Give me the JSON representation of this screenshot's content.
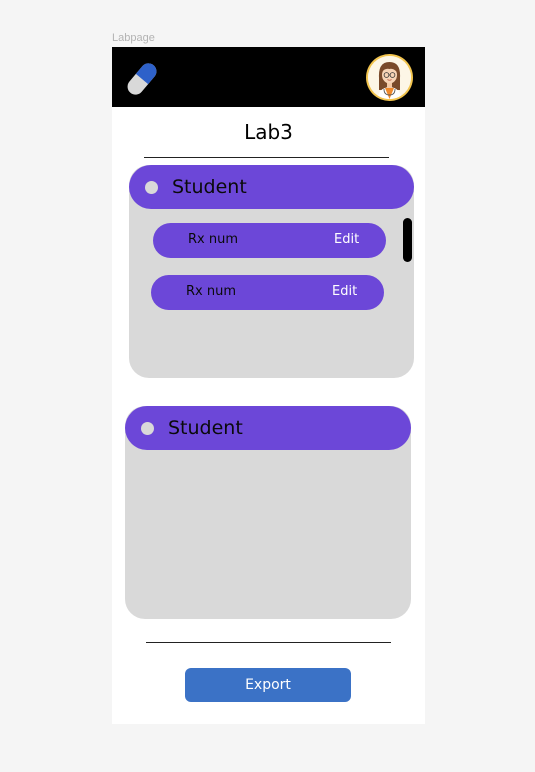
{
  "frame": {
    "label": "Labpage"
  },
  "header": {
    "logo_icon": "pill-icon",
    "avatar_icon": "doctor-avatar-icon"
  },
  "page": {
    "title": "Lab3"
  },
  "cards": [
    {
      "label": "Student",
      "items": [
        {
          "label": "Rx num",
          "action": "Edit"
        },
        {
          "label": "Rx num",
          "action": "Edit"
        }
      ]
    },
    {
      "label": "Student",
      "items": []
    }
  ],
  "footer": {
    "export_label": "Export"
  },
  "colors": {
    "accent": "#6c47d8",
    "card_bg": "#d9d9d9",
    "topbar": "#000000",
    "button": "#3b72c6"
  }
}
